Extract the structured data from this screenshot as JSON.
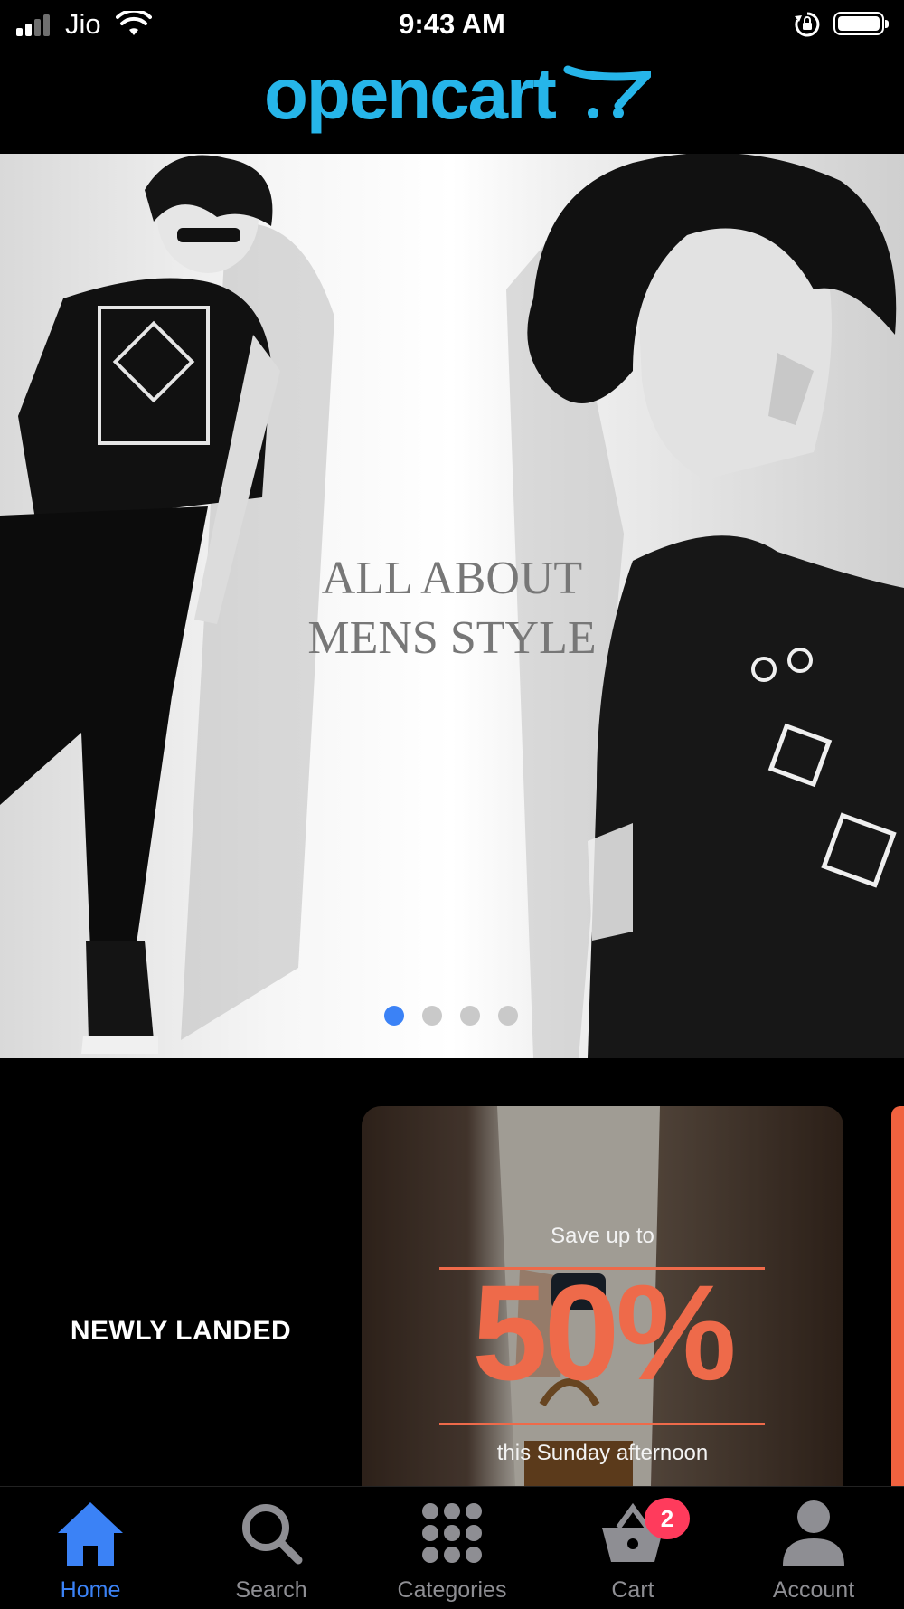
{
  "status_bar": {
    "carrier": "Jio",
    "time": "9:43 AM",
    "signal_bars": 4,
    "signal_bars_active": 2
  },
  "header": {
    "logo_text": "opencart",
    "logo_color": "#26b5e9"
  },
  "hero": {
    "title": "ALL ABOUT\nMENS STYLE",
    "slide_count": 4,
    "active_slide": 1
  },
  "promos": {
    "section_label": "NEWLY LANDED",
    "card": {
      "subtitle": "Save up to",
      "highlight": "50%",
      "tagline": "this Sunday afternoon",
      "accent_color": "#ee6a4a"
    }
  },
  "tab_bar": {
    "active_color": "#3b82f6",
    "inactive_color": "#8e8e93",
    "tabs": [
      {
        "label": "Home",
        "icon": "home-icon",
        "active": true
      },
      {
        "label": "Search",
        "icon": "search-icon",
        "active": false
      },
      {
        "label": "Categories",
        "icon": "grid-icon",
        "active": false
      },
      {
        "label": "Cart",
        "icon": "basket-icon",
        "active": false,
        "badge": "2"
      },
      {
        "label": "Account",
        "icon": "person-icon",
        "active": false
      }
    ]
  }
}
